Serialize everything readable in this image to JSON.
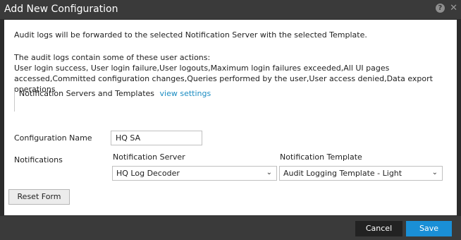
{
  "dialog": {
    "title": "Add New Configuration",
    "icons": [
      "help-icon",
      "close-icon"
    ],
    "help_glyph": "?",
    "close_glyph": "✕"
  },
  "intro": {
    "line1": "Audit logs will be forwarded to the selected Notification Server with the selected Template.",
    "actions_heading": "The audit logs contain some of these user actions:",
    "actions_text": "User login success, User login failure,User logouts,Maximum login failures exceeded,All UI pages accessed,Committed configuration changes,Queries performed by the user,User access denied,Data export operations"
  },
  "section": {
    "label": "Notification Servers and Templates",
    "link": "view settings"
  },
  "form": {
    "config_name_label": "Configuration Name",
    "config_name_value": "HQ SA",
    "notifications_label": "Notifications",
    "server_label": "Notification Server",
    "server_value": "HQ Log Decoder",
    "template_label": "Notification Template",
    "template_value": "Audit Logging Template - Light",
    "chevron_glyph": "⌄"
  },
  "buttons": {
    "reset": "Reset Form",
    "cancel": "Cancel",
    "save": "Save"
  },
  "colors": {
    "accent": "#1a8fd6",
    "link": "#1a8cc2",
    "chrome": "#3a3a3a"
  }
}
